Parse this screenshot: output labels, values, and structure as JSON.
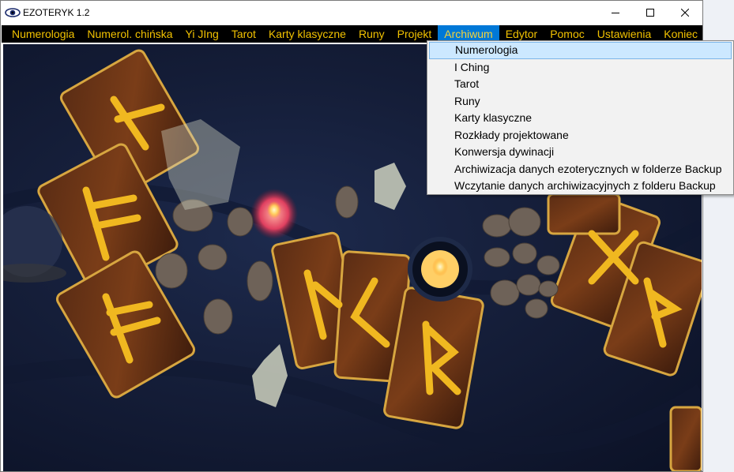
{
  "window": {
    "title": "EZOTERYK 1.2"
  },
  "menu": [
    "Numerologia",
    "Numerol. chińska",
    "Yi JIng",
    "Tarot",
    "Karty klasyczne",
    "Runy",
    "Projekt",
    "Archiwum",
    "Edytor",
    "Pomoc",
    "Ustawienia",
    "Koniec"
  ],
  "active_menu": "Archiwum",
  "dropdown": [
    "Numerologia",
    "I Ching",
    "Tarot",
    "Runy",
    "Karty klasyczne",
    "Rozkłady projektowane",
    "Konwersja dywinacji",
    "Archiwizacja danych ezoterycznych w folderze Backup",
    "Wczytanie danych archiwizacyjnych z folderu Backup"
  ],
  "selected_dropdown_item": "Numerologia",
  "colors": {
    "menu_bg": "#000000",
    "menu_text": "#f2c200",
    "accent": "#0078d7",
    "cloth": "#1b2547"
  }
}
